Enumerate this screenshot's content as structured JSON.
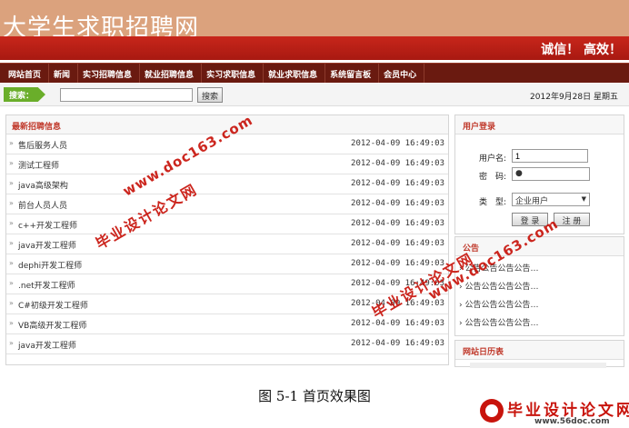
{
  "header": {
    "site_title": "大学生求职招聘网",
    "slogan": "诚信！ 高效！"
  },
  "nav": {
    "items": [
      "网站首页",
      "新闻",
      "实习招聘信息",
      "就业招聘信息",
      "实习求职信息",
      "就业求职信息",
      "系统留言板",
      "会员中心"
    ]
  },
  "search": {
    "tag": "搜索：",
    "value": "",
    "button": "搜索",
    "date": "2012年9月28日 星期五"
  },
  "jobs": {
    "title": "最新招聘信息",
    "items": [
      {
        "title": "售后服务人员",
        "time": "2012-04-09 16:49:03"
      },
      {
        "title": "测试工程师",
        "time": "2012-04-09 16:49:03"
      },
      {
        "title": "java高级架构",
        "time": "2012-04-09 16:49:03"
      },
      {
        "title": "前台人员人员",
        "time": "2012-04-09 16:49:03"
      },
      {
        "title": "c++开发工程师",
        "time": "2012-04-09 16:49:03"
      },
      {
        "title": "java开发工程师",
        "time": "2012-04-09 16:49:03"
      },
      {
        "title": "dephi开发工程师",
        "time": "2012-04-09 16:49:03"
      },
      {
        "title": ".net开发工程师",
        "time": "2012-04-09 16:49:03"
      },
      {
        "title": "C#初级开发工程师",
        "time": "2012-04-09 16:49:03"
      },
      {
        "title": "VB高级开发工程师",
        "time": "2012-04-09 16:49:03"
      },
      {
        "title": "java开发工程师",
        "time": "2012-04-09 16:49:03"
      }
    ]
  },
  "login": {
    "title": "用户登录",
    "username_label": "用户名:",
    "username_value": "1",
    "password_label": "密　码:",
    "password_value": "●",
    "type_label": "类　型:",
    "type_value": "企业用户",
    "login_button": "登 录",
    "register_button": "注 册"
  },
  "notice": {
    "title": "公告",
    "items": [
      "公告公告公告公告…",
      "公告公告公告公告…",
      "公告公告公告公告…",
      "公告公告公告公告…"
    ]
  },
  "calendar": {
    "title": "网站日历表"
  },
  "watermarks": {
    "domain": "www.doc163.com",
    "name": "毕业设计论文网",
    "corner_name": "毕业设计论文网",
    "corner_url": "www.56doc.com"
  },
  "caption": "图 5-1 首页效果图",
  "colors": {
    "banner": "#dba27d",
    "slogan_bar": "#c8261b",
    "nav": "#6a1a10",
    "accent_red": "#c0392b",
    "search_tag": "#6aae2a",
    "watermark": "#c8140c"
  }
}
